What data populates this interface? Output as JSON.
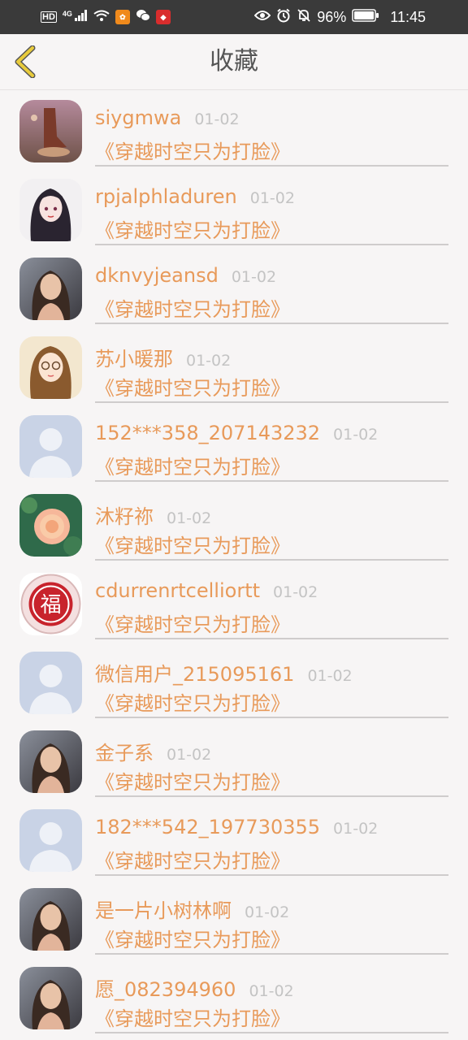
{
  "status_bar": {
    "hd": "HD",
    "network": "4G",
    "battery_percent": "96%",
    "time": "11:45"
  },
  "header": {
    "title": "收藏"
  },
  "favorites": [
    {
      "username": "siygmwa",
      "date": "01-02",
      "book": "《穿越时空只为打脸》",
      "avatar": "photo-shoes"
    },
    {
      "username": "rpjalphladuren",
      "date": "01-02",
      "book": "《穿越时空只为打脸》",
      "avatar": "photo-anime-girl"
    },
    {
      "username": "dknvyjeansd",
      "date": "01-02",
      "book": "《穿越时空只为打脸》",
      "avatar": "photo-woman"
    },
    {
      "username": "苏小暖那",
      "date": "01-02",
      "book": "《穿越时空只为打脸》",
      "avatar": "photo-cartoon-girl"
    },
    {
      "username": "152***358_207143232",
      "date": "01-02",
      "book": "《穿越时空只为打脸》",
      "avatar": "default-avatar"
    },
    {
      "username": "沐籽祢",
      "date": "01-02",
      "book": "《穿越时空只为打脸》",
      "avatar": "photo-flower"
    },
    {
      "username": "cdurrenrtcelliortt",
      "date": "01-02",
      "book": "《穿越时空只为打脸》",
      "avatar": "fu-seal"
    },
    {
      "username": "微信用户_215095161",
      "date": "01-02",
      "book": "《穿越时空只为打脸》",
      "avatar": "default-avatar"
    },
    {
      "username": "金子系",
      "date": "01-02",
      "book": "《穿越时空只为打脸》",
      "avatar": "photo-woman"
    },
    {
      "username": "182***542_197730355",
      "date": "01-02",
      "book": "《穿越时空只为打脸》",
      "avatar": "default-avatar"
    },
    {
      "username": "是一片小树林啊",
      "date": "01-02",
      "book": "《穿越时空只为打脸》",
      "avatar": "photo-woman"
    },
    {
      "username": "愿_082394960",
      "date": "01-02",
      "book": "《穿越时空只为打脸》",
      "avatar": "photo-woman"
    }
  ],
  "colors": {
    "accent": "#e89a5a",
    "back_arrow": "#e8cb3c",
    "status_bar_bg": "#3a3a3a"
  }
}
